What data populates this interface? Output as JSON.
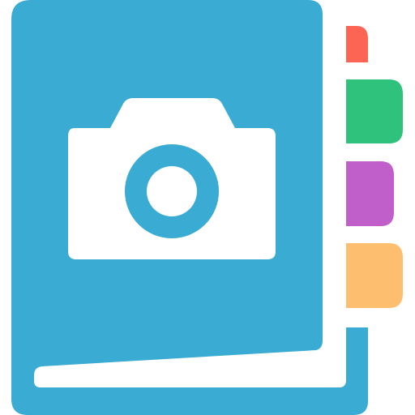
{
  "icon": {
    "name": "photo-album-icon",
    "glyph": "camera-icon",
    "colors": {
      "cover": "#3aabd2",
      "cover_inner_line": "#ffffff",
      "camera_body": "#ffffff",
      "camera_lens_ring": "#3aabd2",
      "tab_1": "#fc6554",
      "tab_2": "#2fc27d",
      "tab_3": "#c05fca",
      "tab_4": "#fdbe70",
      "background": "#ffffff"
    },
    "tabs": [
      {
        "name": "tab-red",
        "color_key": "tab_1"
      },
      {
        "name": "tab-green",
        "color_key": "tab_2"
      },
      {
        "name": "tab-purple",
        "color_key": "tab_3"
      },
      {
        "name": "tab-orange",
        "color_key": "tab_4"
      }
    ]
  }
}
